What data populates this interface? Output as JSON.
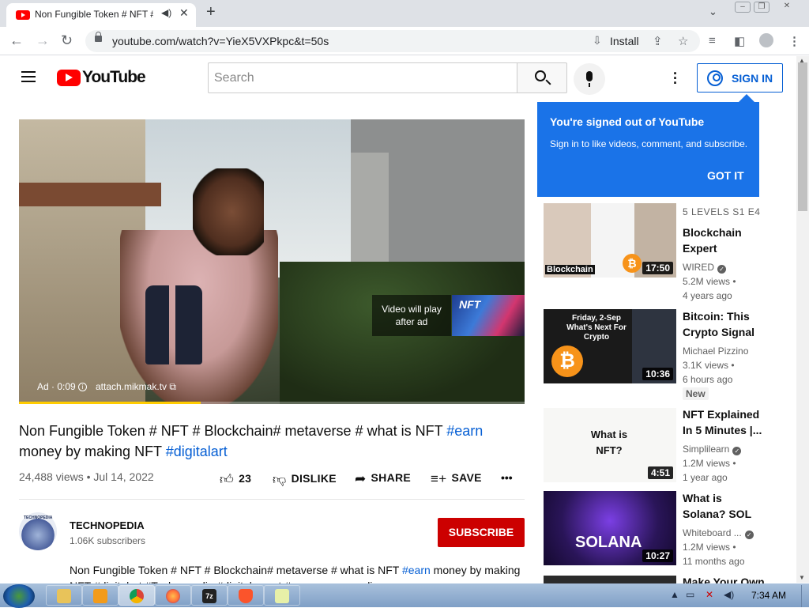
{
  "browser": {
    "tab_title": "Non Fungible Token # NFT #",
    "tab_audio_icon": "speaker-icon",
    "url": "youtube.com/watch?v=YieX5VXPkpc&t=50s",
    "install_label": "Install",
    "new_tab_label": "+"
  },
  "youtube": {
    "wordmark": "YouTube",
    "search_placeholder": "Search",
    "sign_in_label": "SIGN IN"
  },
  "player": {
    "ad_meta": "Ad · 0:09",
    "ad_link": "attach.mikmak.tv",
    "video_will_play": "Video will play after ad",
    "thumb_label": "NFT",
    "ad_progress": 0.36
  },
  "video": {
    "title_part1": "Non Fungible Token # NFT # Blockchain# metaverse # what is NFT ",
    "title_hashtag1": "#earn",
    "title_part2": " money by making NFT ",
    "title_hashtag2": "#digitalart",
    "views_date": "24,488 views • Jul 14, 2022",
    "like_count": "23",
    "dislike_label": "DISLIKE",
    "share_label": "SHARE",
    "save_label": "SAVE",
    "more_label": "•••"
  },
  "channel": {
    "avatar_text": "TECHNOPEDIA",
    "name": "TECHNOPEDIA",
    "subscribers": "1.06K subscribers",
    "subscribe_label": "SUBSCRIBE",
    "description_part1": "Non Fungible Token # NFT # Blockchain# metaverse # what is NFT ",
    "description_hashtag": "#earn",
    "description_part2": " money by making",
    "description_line2": "NFT #digitalart #Technopedia #digital asset # earn money online"
  },
  "popup": {
    "title": "You're signed out of YouTube",
    "body": "Sign in to like videos, comment, and subscribe.",
    "button": "GOT IT"
  },
  "recommendations": [
    {
      "kicker": "5 LEVELS   S1 E4",
      "title": "Blockchain Expert Explain...",
      "channel": "WIRED",
      "views": "5.2M views •",
      "age": "4 years ago",
      "duration": "17:50",
      "thumb_text": "Blockchain"
    },
    {
      "title": "Bitcoin: This Crypto Signal ...",
      "channel": "Michael Pizzino",
      "views": "3.1K views •",
      "age": "6 hours ago",
      "badge": "New",
      "duration": "10:36",
      "thumb_text": "Friday, 2-Sep What's Next For Crypto"
    },
    {
      "title": "NFT Explained In 5 Minutes |...",
      "channel": "Simplilearn",
      "views": "1.2M views •",
      "age": "1 year ago",
      "duration": "4:51",
      "thumb_text": "What is NFT?"
    },
    {
      "title": "What is Solana? SOL Explained...",
      "channel": "Whiteboard ...",
      "views": "1.2M views •",
      "age": "11 months ago",
      "duration": "10:27",
      "thumb_text": "SOLANA"
    },
    {
      "title": "Make Your Own"
    }
  ],
  "taskbar": {
    "clock": "7:34 AM"
  },
  "colors": {
    "yt_red": "#ff0000",
    "link_blue": "#065fd4",
    "popup_blue": "#1a73e8",
    "subscribe_red": "#cc0000",
    "ad_progress_yellow": "#ffcc00"
  }
}
